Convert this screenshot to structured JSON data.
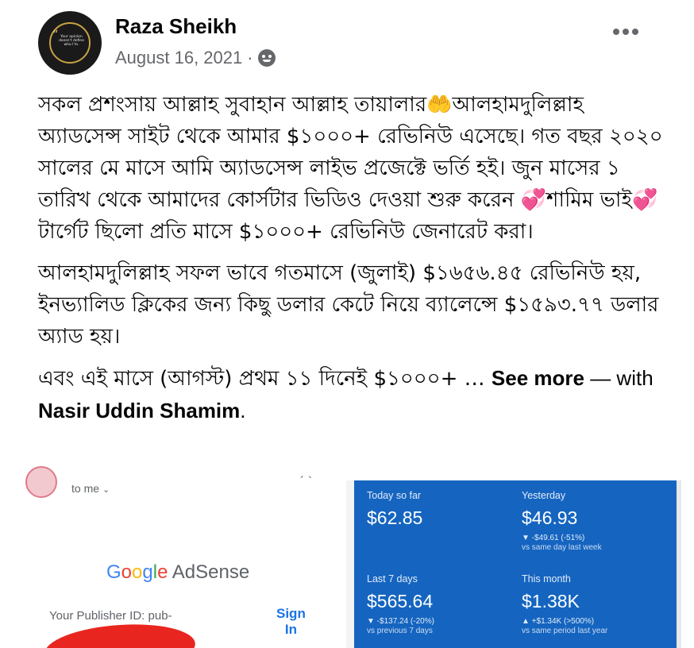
{
  "post": {
    "author": "Raza Sheikh",
    "date": "August 16, 2021",
    "separator": "·",
    "audience_icon": "friends-icon",
    "paragraphs": [
      "সকল প্রশংসায় আল্লাহ সুবাহান আল্লাহ তায়ালার🤲আলহামদুলিল্লাহ অ্যাডসেন্স সাইট থেকে আমার $১০০০+ রেভিনিউ এসেছে। গত বছর ২০২০ সালের মে মাসে আমি অ্যাডসেন্স লাইভ প্রজেক্টে ভর্তি হই। জুন মাসের ১ তারিখ থেকে আমাদের কোর্সটার ভিডিও দেওয়া শুরু করেন 💞শামিম ভাই💞 টার্গেট ছিলো প্রতি মাসে $১০০০+ রেভিনিউ জেনারেট করা।",
      "আলহামদুলিল্লাহ সফল ভাবে গতমাসে (জুলাই) $১৬৫৬.৪৫ রেভিনিউ হয়, ইনভ্যালিড ক্লিকের জন্য কিছু ডলার কেটে নিয়ে ব্যালেন্সে $১৫৯৩.৭৭ ডলার অ্যাড হয়।"
    ],
    "last_line_start": "এবং এই মাসে (আগস্ট) প্রথম ১১ দিনেই $১০০০+ …",
    "see_more": "See more",
    "with_prefix": " — with ",
    "tagged_person": "Nasir Uddin Shamim",
    "end_punct": ".",
    "avatar_text": "Your opinion doesn't define who I'm."
  },
  "image": {
    "email": {
      "to_me": "to me",
      "google_logo": [
        "G",
        "o",
        "o",
        "g",
        "l",
        "e"
      ],
      "adsense": "AdSense",
      "publisher_label": "Your Publisher ID: pub-",
      "sign_in": [
        "Sign",
        "In"
      ]
    },
    "stats": {
      "today": {
        "label": "Today so far",
        "value": "$62.85"
      },
      "yesterday": {
        "label": "Yesterday",
        "value": "$46.93",
        "change": "▼ -$49.61 (-51%)",
        "compare": "vs same day last week"
      },
      "last7": {
        "label": "Last 7 days",
        "value": "$565.64",
        "change": "▼ -$137.24 (-20%)",
        "compare": "vs previous 7 days"
      },
      "month": {
        "label": "This month",
        "value": "$1.38K",
        "change": "▲ +$1.34K (>500%)",
        "compare": "vs same period last year"
      }
    }
  }
}
